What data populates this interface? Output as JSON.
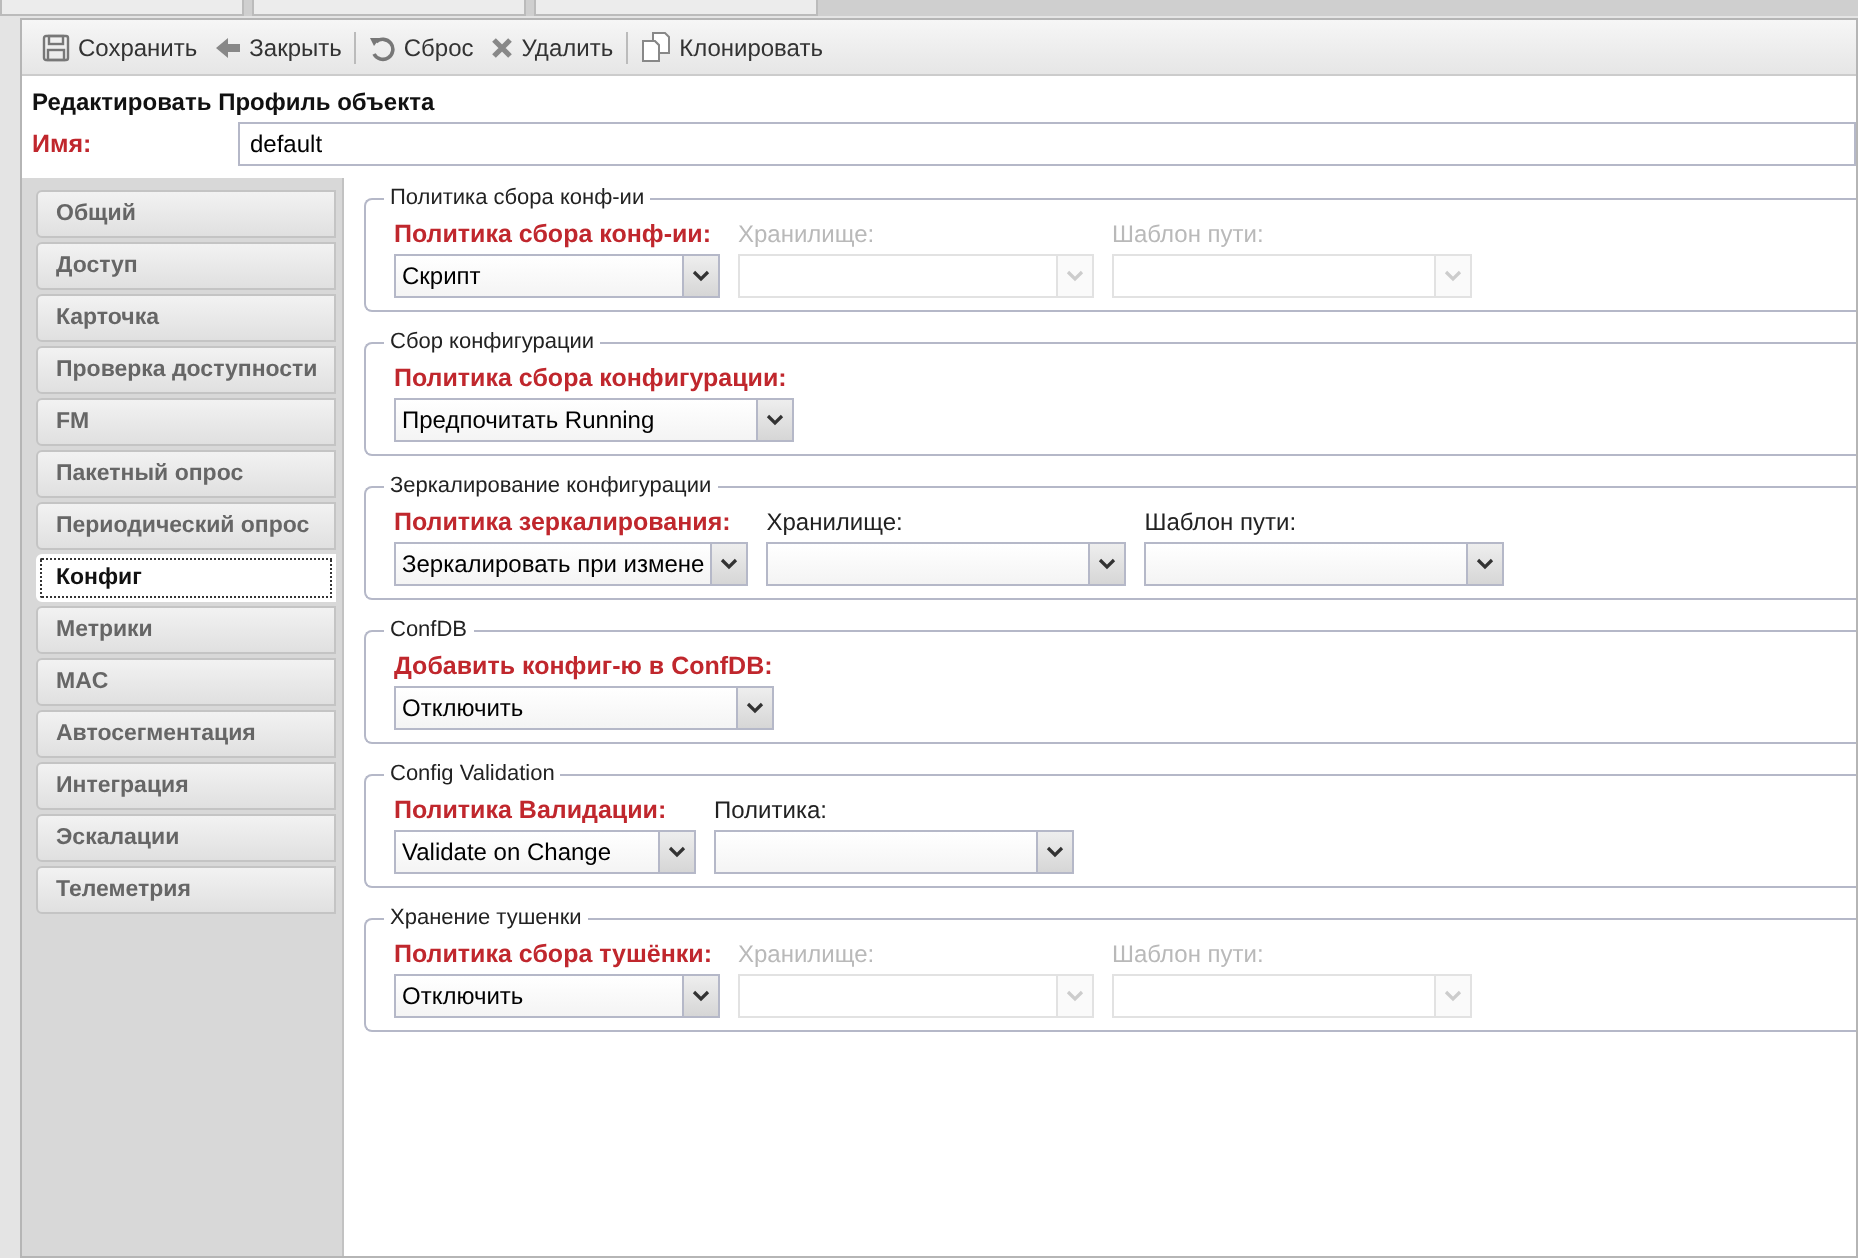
{
  "toolbar": {
    "groups": [
      [
        {
          "label": "Сохранить"
        },
        {
          "label": "Закрыть"
        }
      ],
      [
        {
          "label": "Сброс"
        },
        {
          "label": "Удалить"
        }
      ],
      [
        {
          "label": "Клонировать"
        }
      ]
    ]
  },
  "form": {
    "title": "Редактировать Профиль объекта",
    "name_label": "Имя:",
    "name_value": "default"
  },
  "sidebar": {
    "items": [
      {
        "label": "Общий",
        "selected": false
      },
      {
        "label": "Доступ",
        "selected": false
      },
      {
        "label": "Карточка",
        "selected": false
      },
      {
        "label": "Проверка доступности",
        "selected": false
      },
      {
        "label": "FM",
        "selected": false
      },
      {
        "label": "Пакетный опрос",
        "selected": false
      },
      {
        "label": "Периодический опрос",
        "selected": false
      },
      {
        "label": "Конфиг",
        "selected": true
      },
      {
        "label": "Метрики",
        "selected": false
      },
      {
        "label": "MAC",
        "selected": false
      },
      {
        "label": "Автосегментация",
        "selected": false
      },
      {
        "label": "Интеграция",
        "selected": false
      },
      {
        "label": "Эскалации",
        "selected": false
      },
      {
        "label": "Телеметрия",
        "selected": false
      }
    ]
  },
  "sections": [
    {
      "legend": "Политика сбора конф-ии",
      "fields": [
        {
          "label": "Политика сбора конф-ии:",
          "value": "Скрипт",
          "required": true,
          "disabled": false
        },
        {
          "label": "Хранилище:",
          "required": false,
          "disabled": true
        },
        {
          "label": "Шаблон пути:",
          "required": false,
          "disabled": true
        }
      ]
    },
    {
      "legend": "Сбор конфигурации",
      "fields": [
        {
          "label": "Политика сбора конфигурации:",
          "value": "Предпочитать Running",
          "required": true,
          "disabled": false
        }
      ]
    },
    {
      "legend": "Зеркалирование конфигурации",
      "fields": [
        {
          "label": "Политика зеркалирования:",
          "value": "Зеркалировать при измене",
          "required": true,
          "disabled": false
        },
        {
          "label": "Хранилище:",
          "required": false,
          "disabled": false
        },
        {
          "label": "Шаблон пути:",
          "required": false,
          "disabled": false
        }
      ]
    },
    {
      "legend": "ConfDB",
      "fields": [
        {
          "label": "Добавить конфиг-ю в ConfDB:",
          "value": "Отключить",
          "required": true,
          "disabled": false
        }
      ]
    },
    {
      "legend": "Config Validation",
      "fields": [
        {
          "label": "Политика Валидации:",
          "value": "Validate on Change",
          "required": true,
          "disabled": false
        },
        {
          "label": "Политика:",
          "required": false,
          "disabled": false
        }
      ]
    },
    {
      "legend": "Хранение тушенки",
      "fields": [
        {
          "label": "Политика сбора тушёнки:",
          "value": "Отключить",
          "required": true,
          "disabled": false
        },
        {
          "label": "Хранилище:",
          "required": false,
          "disabled": true
        },
        {
          "label": "Шаблон пути:",
          "required": false,
          "disabled": true
        }
      ]
    }
  ]
}
